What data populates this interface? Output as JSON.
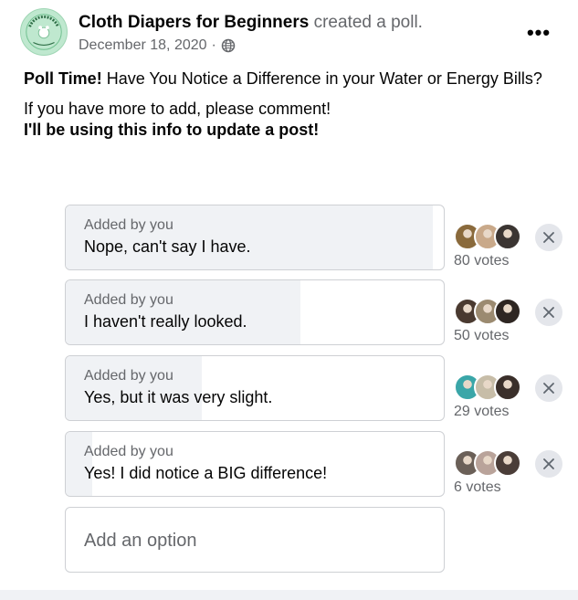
{
  "post": {
    "page_name": "Cloth Diapers for Beginners",
    "action": "created a poll.",
    "date": "December 18, 2020",
    "separator": "·",
    "more_label": "•••",
    "avatar": {
      "logo_text_top": "CLOTH DIAPERS",
      "logo_text_bottom": "for Beginners",
      "background_color": "#bfe8cf"
    },
    "title_bold": "Poll Time!",
    "title_rest": " Have You Notice a Difference in your Water or Energy Bills?",
    "line2": "If you have more to add, please comment!",
    "line3": "I'll be using this info to update a post!"
  },
  "poll": {
    "options": [
      {
        "sub": "Added by you",
        "label": "Nope, can't say I have.",
        "votes": "80 votes",
        "fraction": 0.97,
        "voter_colors": [
          "#8a6a3c",
          "#c9a98a",
          "#3b3532"
        ]
      },
      {
        "sub": "Added by you",
        "label": "I haven't really looked.",
        "votes": "50 votes",
        "fraction": 0.62,
        "voter_colors": [
          "#4a3a30",
          "#9b8a70",
          "#2e2622"
        ]
      },
      {
        "sub": "Added by you",
        "label": "Yes, but it was very slight.",
        "votes": "29 votes",
        "fraction": 0.36,
        "voter_colors": [
          "#3aa6a8",
          "#c7bda8",
          "#3a2f2a"
        ]
      },
      {
        "sub": "Added by you",
        "label": "Yes! I did notice a BIG difference!",
        "votes": "6 votes",
        "fraction": 0.07,
        "voter_colors": [
          "#6b6058",
          "#b9a39a",
          "#4a3d38"
        ]
      }
    ],
    "add_option_placeholder": "Add an option"
  },
  "colors": {
    "secondary_text": "#65676b",
    "fill": "#f0f2f5",
    "border": "#ced0d4"
  }
}
